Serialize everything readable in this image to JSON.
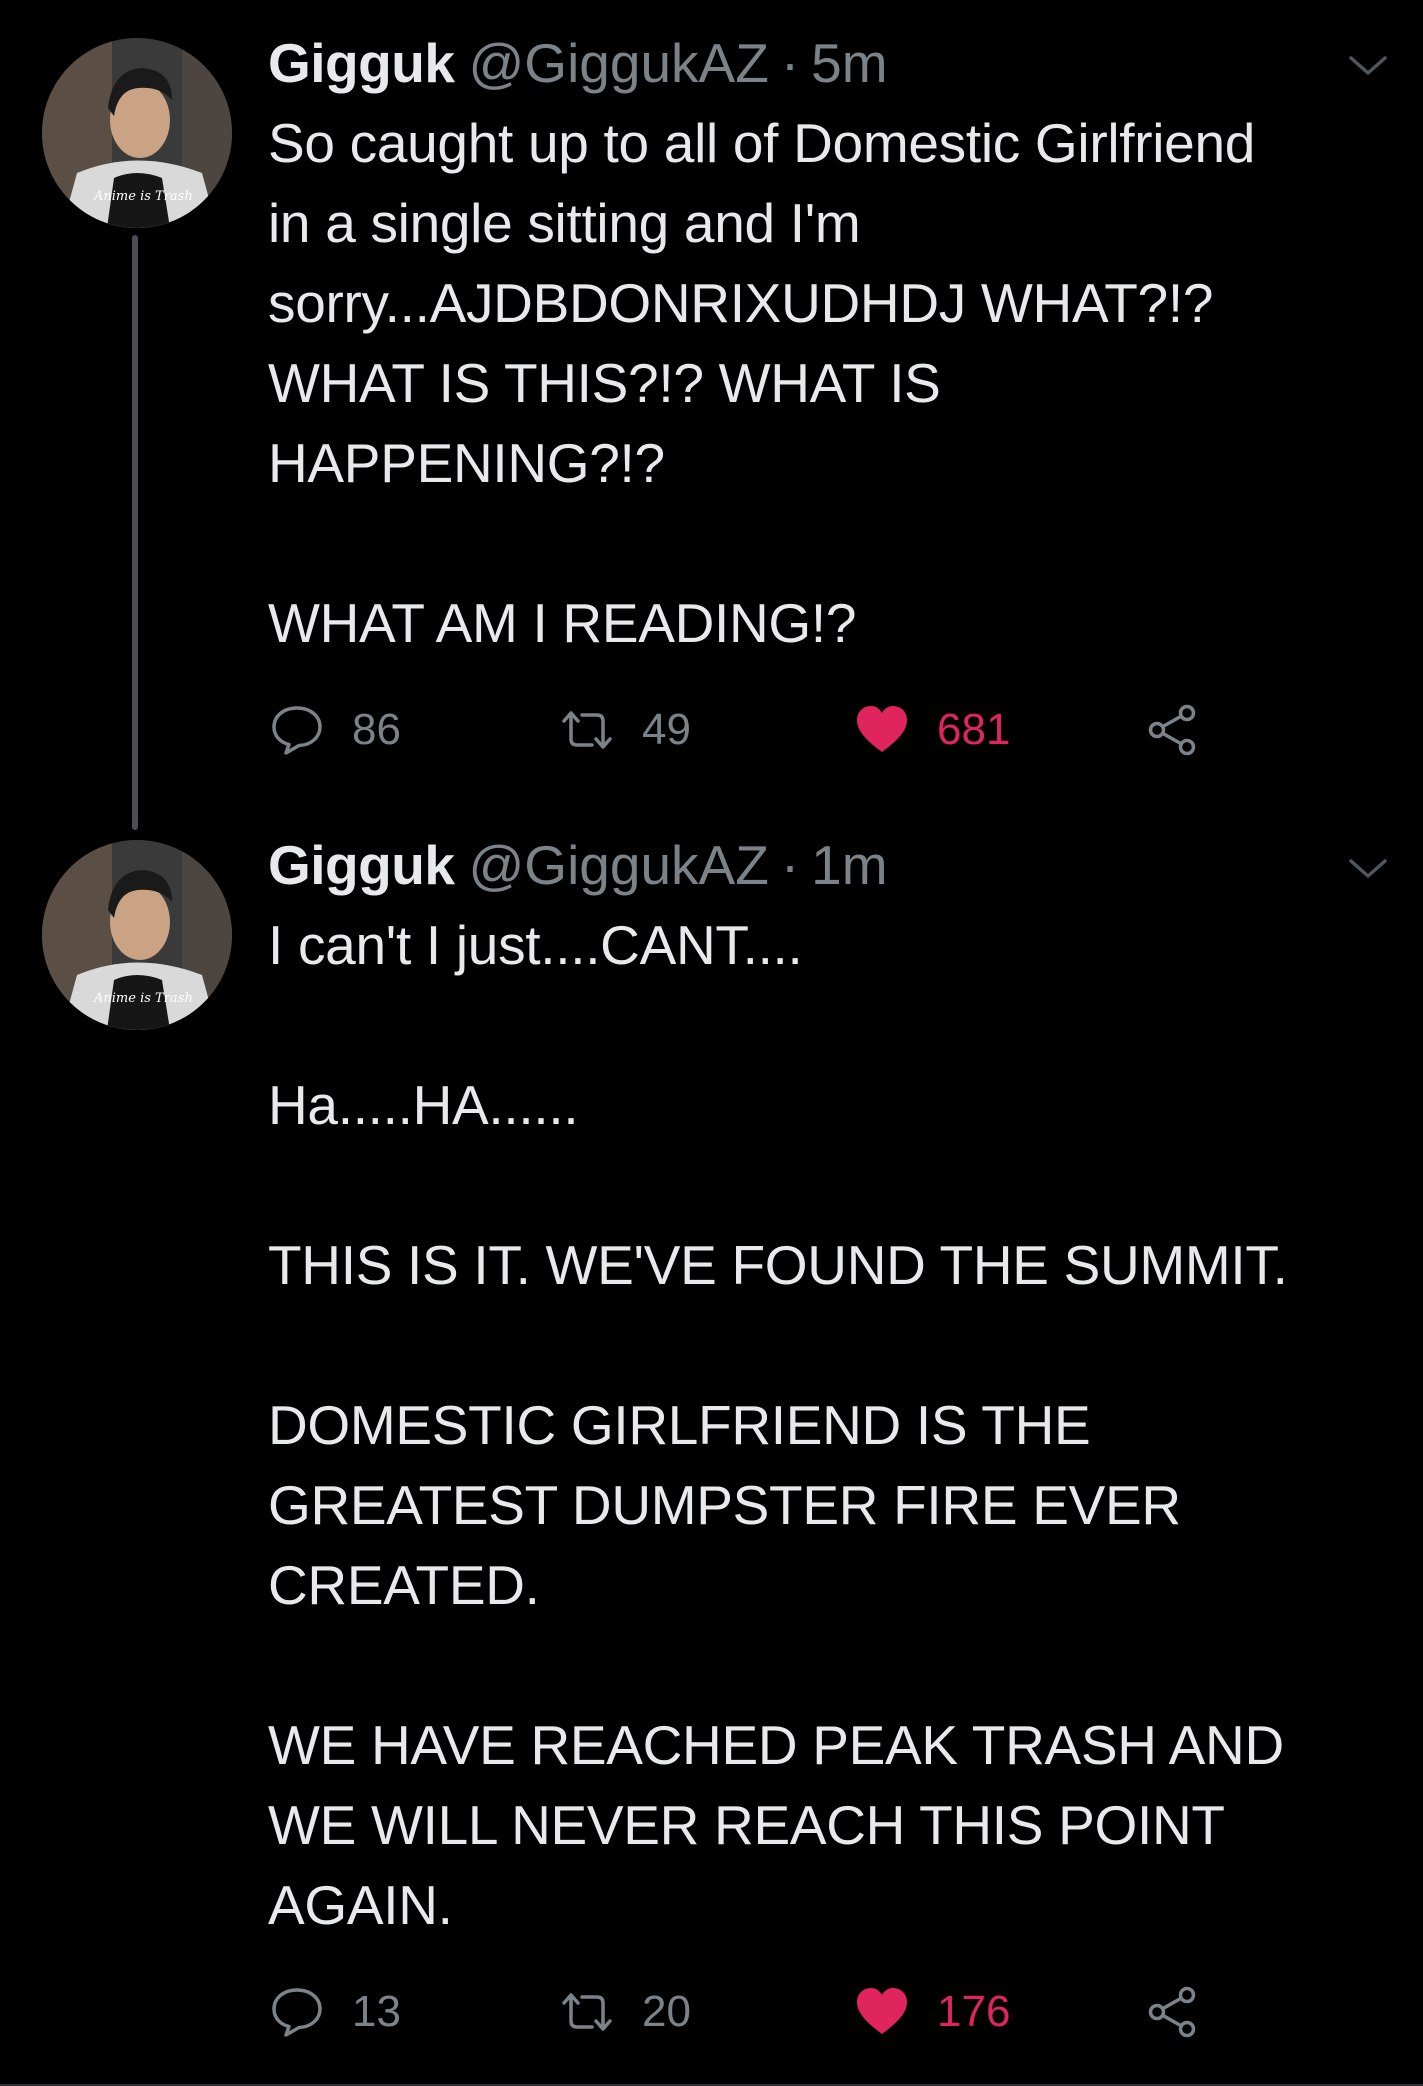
{
  "colors": {
    "background": "#000000",
    "text_primary": "#e7e9ea",
    "text_secondary": "#7b8389",
    "like_active": "#e0245e",
    "thread_line": "#4a4f55"
  },
  "icons": {
    "reply": "speech-bubble-icon",
    "retweet": "retweet-arrows-icon",
    "like": "heart-icon",
    "share": "share-nodes-icon",
    "more": "chevron-down-icon"
  },
  "tweets": [
    {
      "display_name": "Gigguk",
      "handle": "@GiggukAZ",
      "separator": "·",
      "time": "5m",
      "lines": [
        "So caught up to all of Domestic Girlfriend",
        "in a single sitting and I'm",
        "sorry...AJDBDONRIXUDHDJ WHAT?!?",
        "WHAT IS THIS?!? WHAT IS",
        "HAPPENING?!?",
        "",
        "WHAT AM I READING!?"
      ],
      "replies": "86",
      "retweets": "49",
      "likes": "681",
      "liked": true
    },
    {
      "display_name": "Gigguk",
      "handle": "@GiggukAZ",
      "separator": "·",
      "time": "1m",
      "lines": [
        "I can't I just....CANT....",
        "",
        "Ha.....HA......",
        "",
        "THIS IS IT. WE'VE FOUND THE SUMMIT.",
        "",
        "DOMESTIC GIRLFRIEND IS THE",
        "GREATEST DUMPSTER FIRE EVER",
        "CREATED.",
        "",
        "WE HAVE REACHED PEAK TRASH AND",
        "WE WILL NEVER REACH THIS POINT",
        "AGAIN."
      ],
      "replies": "13",
      "retweets": "20",
      "likes": "176",
      "liked": true
    }
  ]
}
